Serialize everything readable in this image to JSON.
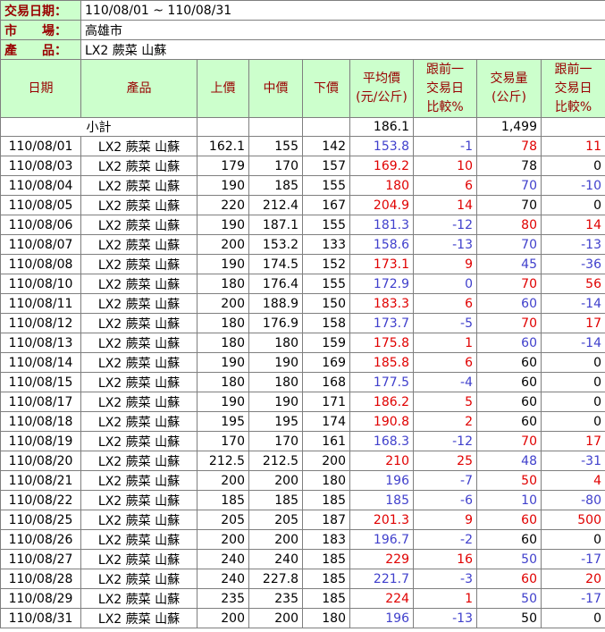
{
  "info": {
    "date_label": "交易日期：",
    "date_value": "110/08/01 ~ 110/08/31",
    "market_label": "市　　場：",
    "market_value": "高雄市",
    "product_label": "產　　品：",
    "product_value": "LX2 蕨菜 山蘇"
  },
  "headers": [
    "日期",
    "產品",
    "上價",
    "中價",
    "下價",
    "平均價\n(元/公斤)",
    "跟前一\n交易日\n比較%",
    "交易量\n(公斤)",
    "跟前一\n交易日\n比較%"
  ],
  "subtotal": {
    "label": "小計",
    "avg": "186.1",
    "volume": "1,499"
  },
  "colors": {
    "header_bg": "#ccffcc",
    "header_text": "#990000",
    "up": "#e00000",
    "down": "#4040cc",
    "flat": "#000000"
  },
  "rows": [
    {
      "date": "110/08/01",
      "product": "LX2 蕨菜 山蘇",
      "high": "162.1",
      "mid": "155",
      "low": "142",
      "avg": "153.8",
      "avg_pct": "-1",
      "vol": "78",
      "vol_pct": "11",
      "avg_dir": "down",
      "vol_dir": "up"
    },
    {
      "date": "110/08/03",
      "product": "LX2 蕨菜 山蘇",
      "high": "179",
      "mid": "170",
      "low": "157",
      "avg": "169.2",
      "avg_pct": "10",
      "vol": "78",
      "vol_pct": "0",
      "avg_dir": "up",
      "vol_dir": "flat"
    },
    {
      "date": "110/08/04",
      "product": "LX2 蕨菜 山蘇",
      "high": "190",
      "mid": "185",
      "low": "155",
      "avg": "180",
      "avg_pct": "6",
      "vol": "70",
      "vol_pct": "-10",
      "avg_dir": "up",
      "vol_dir": "down"
    },
    {
      "date": "110/08/05",
      "product": "LX2 蕨菜 山蘇",
      "high": "220",
      "mid": "212.4",
      "low": "167",
      "avg": "204.9",
      "avg_pct": "14",
      "vol": "70",
      "vol_pct": "0",
      "avg_dir": "up",
      "vol_dir": "flat"
    },
    {
      "date": "110/08/06",
      "product": "LX2 蕨菜 山蘇",
      "high": "190",
      "mid": "187.1",
      "low": "155",
      "avg": "181.3",
      "avg_pct": "-12",
      "vol": "80",
      "vol_pct": "14",
      "avg_dir": "down",
      "vol_dir": "up"
    },
    {
      "date": "110/08/07",
      "product": "LX2 蕨菜 山蘇",
      "high": "200",
      "mid": "153.2",
      "low": "133",
      "avg": "158.6",
      "avg_pct": "-13",
      "vol": "70",
      "vol_pct": "-13",
      "avg_dir": "down",
      "vol_dir": "down"
    },
    {
      "date": "110/08/08",
      "product": "LX2 蕨菜 山蘇",
      "high": "190",
      "mid": "174.5",
      "low": "152",
      "avg": "173.1",
      "avg_pct": "9",
      "vol": "45",
      "vol_pct": "-36",
      "avg_dir": "up",
      "vol_dir": "down"
    },
    {
      "date": "110/08/10",
      "product": "LX2 蕨菜 山蘇",
      "high": "180",
      "mid": "176.4",
      "low": "155",
      "avg": "172.9",
      "avg_pct": "0",
      "vol": "70",
      "vol_pct": "56",
      "avg_dir": "down",
      "vol_dir": "up"
    },
    {
      "date": "110/08/11",
      "product": "LX2 蕨菜 山蘇",
      "high": "200",
      "mid": "188.9",
      "low": "150",
      "avg": "183.3",
      "avg_pct": "6",
      "vol": "60",
      "vol_pct": "-14",
      "avg_dir": "up",
      "vol_dir": "down"
    },
    {
      "date": "110/08/12",
      "product": "LX2 蕨菜 山蘇",
      "high": "180",
      "mid": "176.9",
      "low": "158",
      "avg": "173.7",
      "avg_pct": "-5",
      "vol": "70",
      "vol_pct": "17",
      "avg_dir": "down",
      "vol_dir": "up"
    },
    {
      "date": "110/08/13",
      "product": "LX2 蕨菜 山蘇",
      "high": "180",
      "mid": "180",
      "low": "159",
      "avg": "175.8",
      "avg_pct": "1",
      "vol": "60",
      "vol_pct": "-14",
      "avg_dir": "up",
      "vol_dir": "down"
    },
    {
      "date": "110/08/14",
      "product": "LX2 蕨菜 山蘇",
      "high": "190",
      "mid": "190",
      "low": "169",
      "avg": "185.8",
      "avg_pct": "6",
      "vol": "60",
      "vol_pct": "0",
      "avg_dir": "up",
      "vol_dir": "flat"
    },
    {
      "date": "110/08/15",
      "product": "LX2 蕨菜 山蘇",
      "high": "180",
      "mid": "180",
      "low": "168",
      "avg": "177.5",
      "avg_pct": "-4",
      "vol": "60",
      "vol_pct": "0",
      "avg_dir": "down",
      "vol_dir": "flat"
    },
    {
      "date": "110/08/17",
      "product": "LX2 蕨菜 山蘇",
      "high": "190",
      "mid": "190",
      "low": "171",
      "avg": "186.2",
      "avg_pct": "5",
      "vol": "60",
      "vol_pct": "0",
      "avg_dir": "up",
      "vol_dir": "flat"
    },
    {
      "date": "110/08/18",
      "product": "LX2 蕨菜 山蘇",
      "high": "195",
      "mid": "195",
      "low": "174",
      "avg": "190.8",
      "avg_pct": "2",
      "vol": "60",
      "vol_pct": "0",
      "avg_dir": "up",
      "vol_dir": "flat"
    },
    {
      "date": "110/08/19",
      "product": "LX2 蕨菜 山蘇",
      "high": "170",
      "mid": "170",
      "low": "161",
      "avg": "168.3",
      "avg_pct": "-12",
      "vol": "70",
      "vol_pct": "17",
      "avg_dir": "down",
      "vol_dir": "up"
    },
    {
      "date": "110/08/20",
      "product": "LX2 蕨菜 山蘇",
      "high": "212.5",
      "mid": "212.5",
      "low": "200",
      "avg": "210",
      "avg_pct": "25",
      "vol": "48",
      "vol_pct": "-31",
      "avg_dir": "up",
      "vol_dir": "down"
    },
    {
      "date": "110/08/21",
      "product": "LX2 蕨菜 山蘇",
      "high": "200",
      "mid": "200",
      "low": "180",
      "avg": "196",
      "avg_pct": "-7",
      "vol": "50",
      "vol_pct": "4",
      "avg_dir": "down",
      "vol_dir": "up"
    },
    {
      "date": "110/08/22",
      "product": "LX2 蕨菜 山蘇",
      "high": "185",
      "mid": "185",
      "low": "185",
      "avg": "185",
      "avg_pct": "-6",
      "vol": "10",
      "vol_pct": "-80",
      "avg_dir": "down",
      "vol_dir": "down"
    },
    {
      "date": "110/08/25",
      "product": "LX2 蕨菜 山蘇",
      "high": "205",
      "mid": "205",
      "low": "187",
      "avg": "201.3",
      "avg_pct": "9",
      "vol": "60",
      "vol_pct": "500",
      "avg_dir": "up",
      "vol_dir": "up"
    },
    {
      "date": "110/08/26",
      "product": "LX2 蕨菜 山蘇",
      "high": "200",
      "mid": "200",
      "low": "183",
      "avg": "196.7",
      "avg_pct": "-2",
      "vol": "60",
      "vol_pct": "0",
      "avg_dir": "down",
      "vol_dir": "flat"
    },
    {
      "date": "110/08/27",
      "product": "LX2 蕨菜 山蘇",
      "high": "240",
      "mid": "240",
      "low": "185",
      "avg": "229",
      "avg_pct": "16",
      "vol": "50",
      "vol_pct": "-17",
      "avg_dir": "up",
      "vol_dir": "down"
    },
    {
      "date": "110/08/28",
      "product": "LX2 蕨菜 山蘇",
      "high": "240",
      "mid": "227.8",
      "low": "185",
      "avg": "221.7",
      "avg_pct": "-3",
      "vol": "60",
      "vol_pct": "20",
      "avg_dir": "down",
      "vol_dir": "up"
    },
    {
      "date": "110/08/29",
      "product": "LX2 蕨菜 山蘇",
      "high": "235",
      "mid": "235",
      "low": "185",
      "avg": "224",
      "avg_pct": "1",
      "vol": "50",
      "vol_pct": "-17",
      "avg_dir": "up",
      "vol_dir": "down"
    },
    {
      "date": "110/08/31",
      "product": "LX2 蕨菜 山蘇",
      "high": "200",
      "mid": "200",
      "low": "180",
      "avg": "196",
      "avg_pct": "-13",
      "vol": "50",
      "vol_pct": "0",
      "avg_dir": "down",
      "vol_dir": "flat"
    }
  ]
}
